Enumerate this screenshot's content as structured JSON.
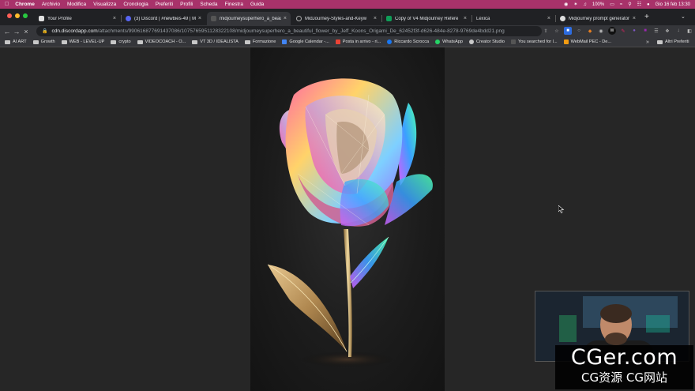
{
  "menubar": {
    "items": [
      "Chrome",
      "Archivio",
      "Modifica",
      "Visualizza",
      "Cronologia",
      "Preferiti",
      "Profili",
      "Scheda",
      "Finestra",
      "Guida"
    ],
    "battery": "100%",
    "datetime": "Gio 16 feb  13:30"
  },
  "tabs": [
    {
      "title": "Your Profile",
      "close": "×"
    },
    {
      "title": "(3) Discord | #newbies-49 | M",
      "close": "×"
    },
    {
      "title": "midjourneysuperhero_a_beau",
      "close": "×"
    },
    {
      "title": "MidJourney-Styles-and-Keyw",
      "close": "×"
    },
    {
      "title": "Copy of V4 Midjourney Refere",
      "close": "×"
    },
    {
      "title": "Lexica",
      "close": "×"
    },
    {
      "title": "Midjourney prompt generator",
      "close": "×"
    }
  ],
  "new_tab": "+",
  "address": {
    "host": "cdn.discordapp.com",
    "path": "/attachments/990616877691437086/1075765951128322108/midjourneysuperhero_a_beautiful_flower_by_Jeff_Koons_Origami_De_62452f3f-d626-484e-8278-9769de4bdd21.png"
  },
  "bookmarks": [
    {
      "label": "AI ART",
      "kind": "folder"
    },
    {
      "label": "Growth",
      "kind": "folder"
    },
    {
      "label": "WEB - LEVEL-UP",
      "kind": "folder"
    },
    {
      "label": "crypto",
      "kind": "folder"
    },
    {
      "label": "VIDEOCOACH - O...",
      "kind": "folder"
    },
    {
      "label": "VT 3D / IDEALISTA",
      "kind": "folder"
    },
    {
      "label": "Formazione",
      "kind": "folder"
    },
    {
      "label": "Google Calendar -...",
      "kind": "site",
      "color": "#4285f4"
    },
    {
      "label": "Posta in arrivo - ri...",
      "kind": "site",
      "color": "#ea4335"
    },
    {
      "label": "Riccardo Scrocca",
      "kind": "site",
      "color": "#1877f2"
    },
    {
      "label": "WhatsApp",
      "kind": "site",
      "color": "#25d366"
    },
    {
      "label": "Creator Studio",
      "kind": "site",
      "color": "#c9c9c9"
    },
    {
      "label": "You searched for l...",
      "kind": "site",
      "color": "#555555"
    },
    {
      "label": "WebMail PEC - De...",
      "kind": "site",
      "color": "#f39c12"
    }
  ],
  "bookmarks_more": "»",
  "bookmarks_other": "Altri Preferiti",
  "watermark": {
    "main": "CGer.com",
    "sub": "CG资源 CG网站"
  }
}
